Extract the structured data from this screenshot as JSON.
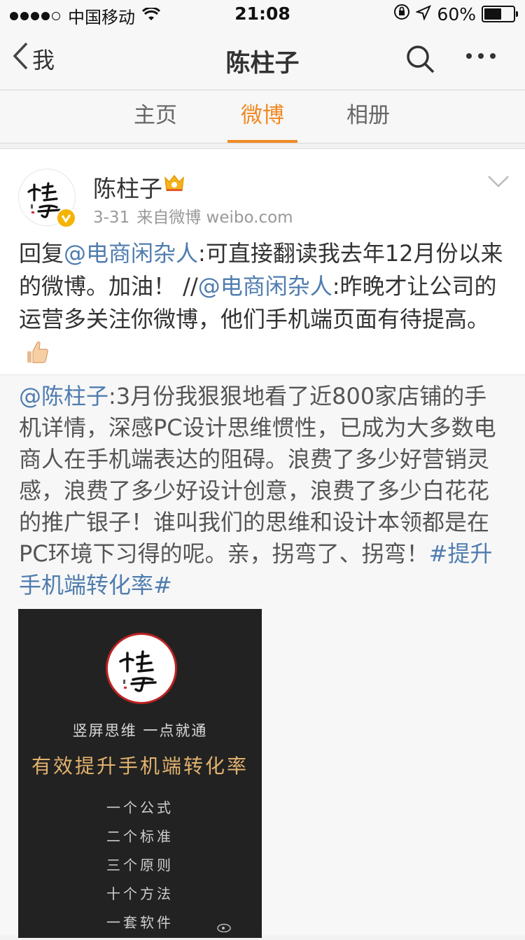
{
  "status_bar": {
    "carrier": "中国移动",
    "time": "21:08",
    "battery": "60%",
    "battery_level": 0.6
  },
  "nav": {
    "back_label": "我",
    "title": "陈柱子",
    "icons": [
      "chevron-left-icon",
      "search-icon",
      "more-icon"
    ]
  },
  "tabs": [
    {
      "label": "主页",
      "active": false
    },
    {
      "label": "微博",
      "active": true
    },
    {
      "label": "相册",
      "active": false
    }
  ],
  "post": {
    "author": "陈柱子",
    "date": "3-31",
    "source": "来自微博 weibo.com",
    "text": {
      "p1": "回复",
      "mention1": "@电商闲杂人",
      "p2": ":可直接翻读我去年12月份以来的微博。加油！ //",
      "mention2": "@电商闲杂人",
      "p3": ":昨晚才让公司的运营多关注你微博，他们手机端页面有待提高。"
    }
  },
  "retweet": {
    "mention": "@陈柱子",
    "text": ":3月份我狠狠地看了近800家店铺的手机详情，深感PC设计思维惯性，已成为大多数电商人在手机端表达的阻碍。浪费了多少好营销灵感，浪费了多少好设计创意，浪费了多少白花花的推广银子！谁叫我们的思维和设计本领都是在PC环境下习得的呢。亲，拐弯了、拐弯！",
    "hashtag": "#提升手机端转化率#",
    "image": {
      "subtitle": "竖屏思维 一点就通",
      "title": "有效提升手机端转化率",
      "items": [
        "一个公式",
        "二个标准",
        "三个原则",
        "十个方法",
        "一套软件"
      ]
    }
  },
  "colors": {
    "accent": "#f08a24",
    "link": "#507daf",
    "verified": "#f4b400"
  }
}
